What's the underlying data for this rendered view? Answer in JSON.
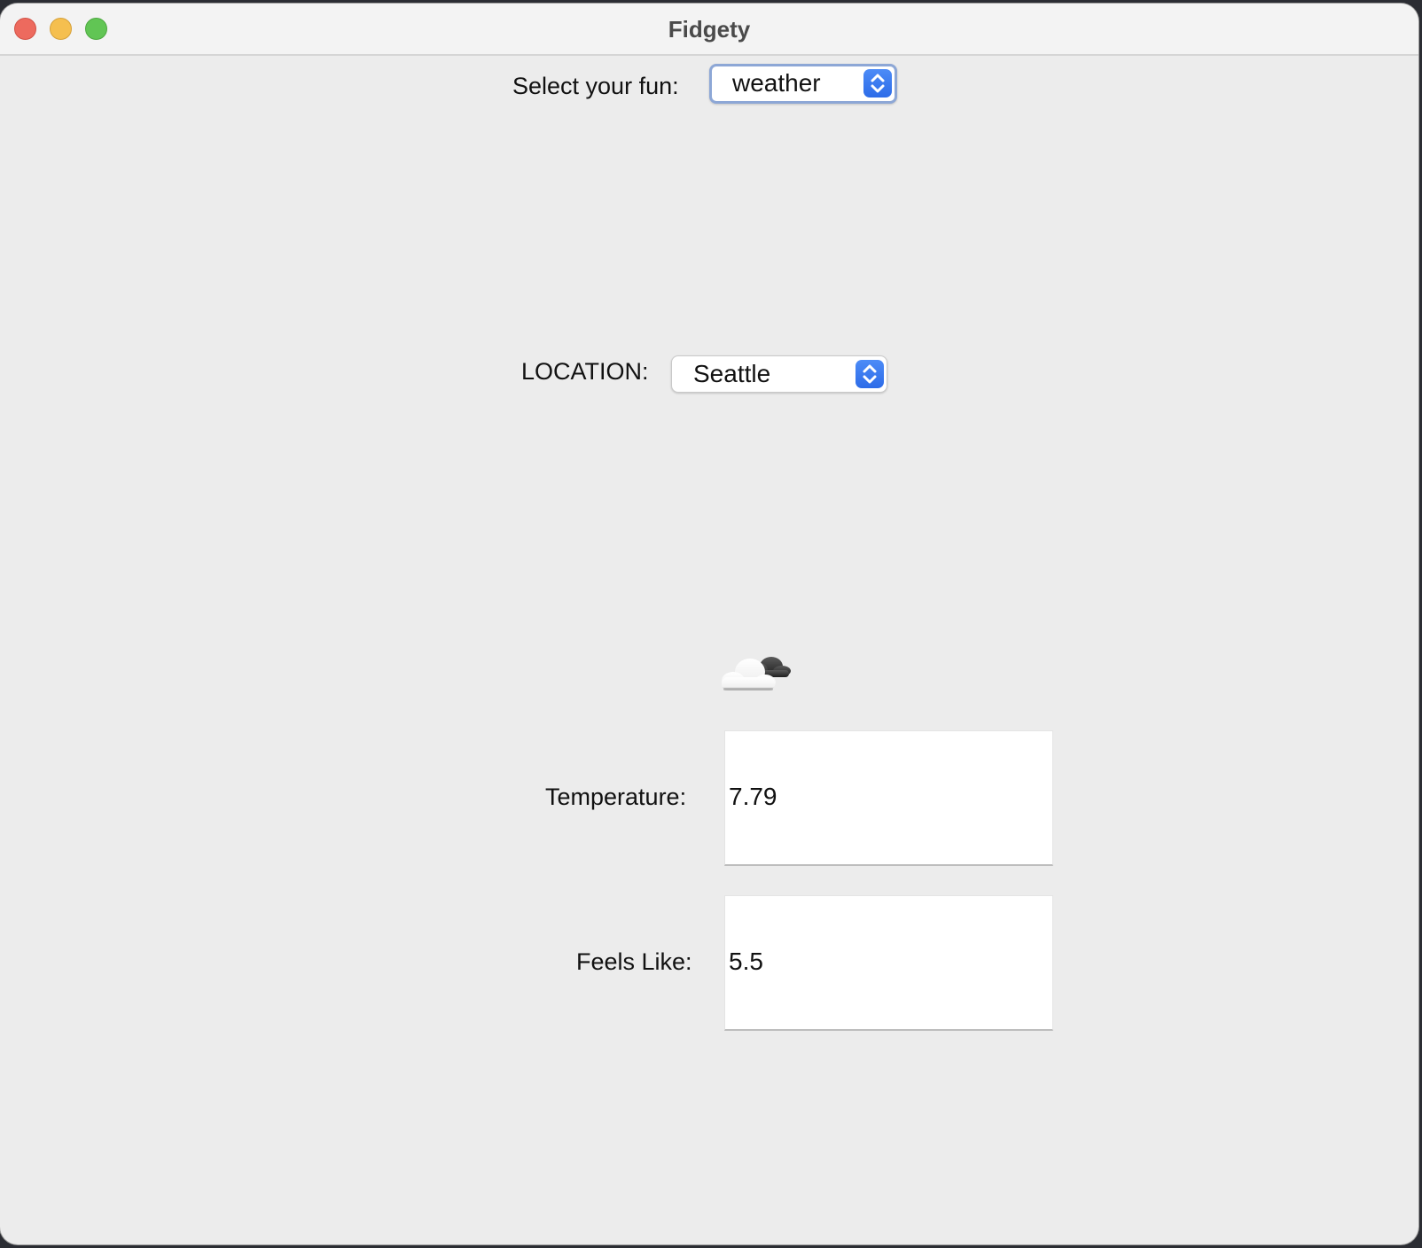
{
  "window": {
    "title": "Fidgety"
  },
  "fun_selector": {
    "label": "Select your fun:",
    "value": "weather"
  },
  "location_selector": {
    "label": "LOCATION:",
    "value": "Seattle"
  },
  "weather": {
    "icon": "partly-cloudy-icon",
    "temperature_label": "Temperature:",
    "temperature_value": "7.79",
    "feels_like_label": "Feels Like:",
    "feels_like_value": "5.5"
  },
  "colors": {
    "accent": "#3478f6",
    "window_bg": "#ececec",
    "close": "#ed6a5e",
    "minimize": "#f5bf4f",
    "maximize": "#61c554"
  }
}
